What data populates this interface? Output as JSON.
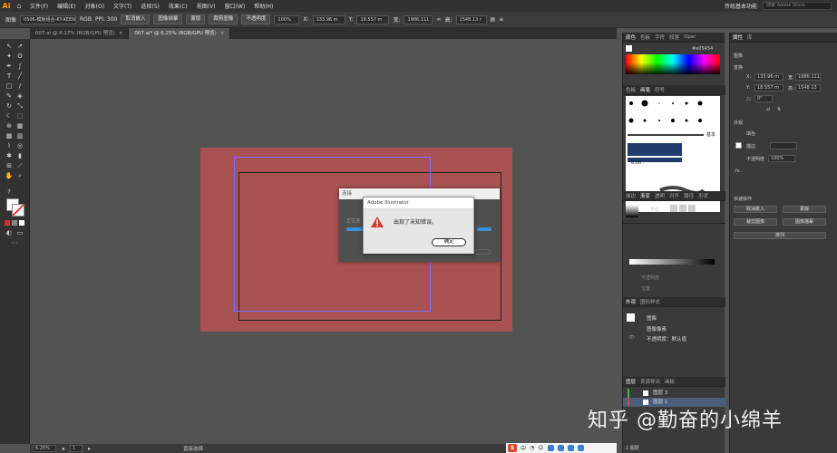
{
  "app": {
    "logo": "Ai",
    "menus": [
      "文件(F)",
      "编辑(E)",
      "对象(O)",
      "文字(T)",
      "选择(S)",
      "效果(C)",
      "视图(V)",
      "窗口(W)",
      "帮助(H)"
    ],
    "workspace": "传统基本功能",
    "stock_search_placeholder": "搜索 Adobe Stock"
  },
  "control_bar": {
    "object_label": "图像",
    "file_name": "0506-模板组合-KY-KEEN...",
    "color_mode": "RGB",
    "ppi": "PPI: 300",
    "embed_button": "取消嵌入",
    "trace_button": "图像描摹",
    "mask_button": "蒙版",
    "crop_button": "裁剪图像",
    "opacity_label": "不透明度",
    "opacity_value": "100%",
    "x_label": "X:",
    "x_value": "133.96 m",
    "y_label": "Y:",
    "y_value": "18.557 m",
    "w_label": "宽:",
    "w_value": "1986.111",
    "h_label": "高:",
    "h_value": "1548.13 r"
  },
  "doc_tabs": [
    {
      "label": "007.ai @ 4.17% (RGB/GPU 预览)",
      "active": false
    },
    {
      "label": "007.ai* @ 6.25% (RGB/GPU 预览)",
      "active": true
    }
  ],
  "dialogs": {
    "progress_title": "连接",
    "progress_label": "正在连",
    "alert_title": "Adobe Illustrator",
    "alert_message": "出现了未知错误。",
    "alert_ok": "确定"
  },
  "status": {
    "zoom": "6.25%",
    "page": "1",
    "tool": "直接选择"
  },
  "ime": {
    "logo": "S",
    "lang": "中"
  },
  "color_panel": {
    "tabs": [
      "颜色",
      "色板",
      "字符",
      "段落",
      "Oper"
    ],
    "hex": "e05454"
  },
  "brush_panel": {
    "tabs": [
      "色板",
      "画笔",
      "符号"
    ],
    "basic_label": "基本",
    "size_value": "6.00"
  },
  "gradient_panel": {
    "tabs": [
      "描边",
      "渐变",
      "透明",
      "对齐",
      "路径",
      "形状"
    ],
    "type_label": "类型",
    "opacity_label": "不透明度",
    "position_label": "位置"
  },
  "appearance_panel": {
    "tabs": [
      "外观",
      "图形样式"
    ],
    "item_label": "图像",
    "item2_label": "图像像素",
    "item3_label": "不透明度：默认值"
  },
  "layers_panel": {
    "tabs": [
      "图层",
      "资源导出",
      "画板"
    ],
    "layers": [
      "图层 3",
      "图层 1"
    ],
    "count_label": "1 图层"
  },
  "properties_panel": {
    "tabs": [
      "属性",
      "库"
    ],
    "object_type": "图像",
    "transform_title": "变换",
    "x_label": "X:",
    "x_value": "133.96 m",
    "y_label": "Y:",
    "y_value": "18.557 m",
    "w_label": "宽:",
    "w_value": "1986.111",
    "h_label": "高:",
    "h_value": "1548.13",
    "angle_label": "△:",
    "angle_value": "0°",
    "appearance_title": "外观",
    "fill_label": "填色",
    "stroke_label": "描边",
    "opacity_label": "不透明度",
    "opacity_value": "100%",
    "fx_label": "fx.",
    "quick_actions_title": "快速操作",
    "btn_embed": "取消嵌入",
    "btn_mask": "蒙版",
    "btn_crop": "裁剪图像",
    "btn_trace": "图像描摹",
    "btn_arrange": "排列"
  },
  "watermark": "知乎 @勤奋的小绵羊"
}
